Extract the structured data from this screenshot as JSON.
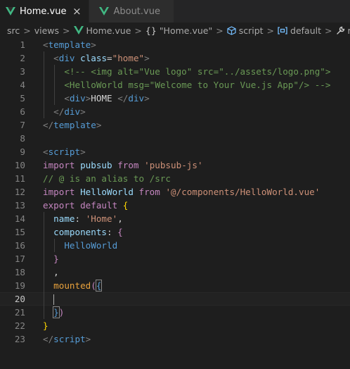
{
  "tabs": [
    {
      "label": "Home.vue",
      "active": true,
      "close": "×"
    },
    {
      "label": "About.vue",
      "active": false
    }
  ],
  "breadcrumb": {
    "items": [
      "src",
      "views",
      "Home.vue",
      "\"Home.vue\"",
      "script",
      "default",
      "mounted"
    ],
    "separator": ">",
    "braces": "{}"
  },
  "editor": {
    "line_numbers": [
      "1",
      "2",
      "3",
      "4",
      "5",
      "6",
      "7",
      "8",
      "9",
      "10",
      "11",
      "12",
      "13",
      "14",
      "15",
      "16",
      "17",
      "18",
      "19",
      "20",
      "21",
      "22",
      "23"
    ],
    "current_line": 20,
    "lines": [
      [
        {
          "t": "<",
          "c": "t-br"
        },
        {
          "t": "template",
          "c": "t-tag"
        },
        {
          "t": ">",
          "c": "t-br"
        }
      ],
      [
        {
          "t": "  "
        },
        {
          "t": "<",
          "c": "t-br"
        },
        {
          "t": "div",
          "c": "t-tag"
        },
        {
          "t": " "
        },
        {
          "t": "class",
          "c": "t-attr"
        },
        {
          "t": "=",
          "c": "t-pl"
        },
        {
          "t": "\"home\"",
          "c": "t-str"
        },
        {
          "t": ">",
          "c": "t-br"
        }
      ],
      [
        {
          "t": "    "
        },
        {
          "t": "<!-- <img alt=\"Vue logo\" src=\"../assets/logo.png\">",
          "c": "t-cm"
        }
      ],
      [
        {
          "t": "    "
        },
        {
          "t": "<HelloWorld msg=\"Welcome to Your Vue.js App\"/> -->",
          "c": "t-cm"
        }
      ],
      [
        {
          "t": "    "
        },
        {
          "t": "<",
          "c": "t-br"
        },
        {
          "t": "div",
          "c": "t-tag"
        },
        {
          "t": ">",
          "c": "t-br"
        },
        {
          "t": "HOME ",
          "c": "t-pl"
        },
        {
          "t": "</",
          "c": "t-br"
        },
        {
          "t": "div",
          "c": "t-tag"
        },
        {
          "t": ">",
          "c": "t-br"
        }
      ],
      [
        {
          "t": "  "
        },
        {
          "t": "</",
          "c": "t-br"
        },
        {
          "t": "div",
          "c": "t-tag"
        },
        {
          "t": ">",
          "c": "t-br"
        }
      ],
      [
        {
          "t": "</",
          "c": "t-br"
        },
        {
          "t": "template",
          "c": "t-tag"
        },
        {
          "t": ">",
          "c": "t-br"
        }
      ],
      [],
      [
        {
          "t": "<",
          "c": "t-br"
        },
        {
          "t": "script",
          "c": "t-tag"
        },
        {
          "t": ">",
          "c": "t-br"
        }
      ],
      [
        {
          "t": "import",
          "c": "t-kw"
        },
        {
          "t": " "
        },
        {
          "t": "pubsub",
          "c": "t-var"
        },
        {
          "t": " "
        },
        {
          "t": "from",
          "c": "t-kw"
        },
        {
          "t": " "
        },
        {
          "t": "'pubsub-js'",
          "c": "t-str"
        }
      ],
      [
        {
          "t": "// @ is an alias to /src",
          "c": "t-cm"
        }
      ],
      [
        {
          "t": "import",
          "c": "t-kw"
        },
        {
          "t": " "
        },
        {
          "t": "HelloWorld",
          "c": "t-var"
        },
        {
          "t": " "
        },
        {
          "t": "from",
          "c": "t-kw"
        },
        {
          "t": " "
        },
        {
          "t": "'@/components/HelloWorld.vue'",
          "c": "t-str"
        }
      ],
      [
        {
          "t": "export",
          "c": "t-kw"
        },
        {
          "t": " "
        },
        {
          "t": "default",
          "c": "t-kw"
        },
        {
          "t": " "
        },
        {
          "t": "{",
          "c": "t-gold"
        }
      ],
      [
        {
          "t": "  "
        },
        {
          "t": "name",
          "c": "t-var"
        },
        {
          "t": ": ",
          "c": "t-pl"
        },
        {
          "t": "'Home'",
          "c": "t-str"
        },
        {
          "t": ",",
          "c": "t-pl"
        }
      ],
      [
        {
          "t": "  "
        },
        {
          "t": "components",
          "c": "t-var"
        },
        {
          "t": ": ",
          "c": "t-pl"
        },
        {
          "t": "{",
          "c": "t-kw"
        }
      ],
      [
        {
          "t": "    "
        },
        {
          "t": "HelloWorld",
          "c": "t-blue"
        }
      ],
      [
        {
          "t": "  "
        },
        {
          "t": "}",
          "c": "t-kw"
        }
      ],
      [
        {
          "t": "  "
        },
        {
          "t": ",",
          "c": "t-pl"
        }
      ],
      [
        {
          "t": "  "
        },
        {
          "t": "mounted",
          "c": "t-mth"
        },
        {
          "t": "(",
          "c": "t-kw"
        },
        {
          "t": "{",
          "c": "t-blue",
          "bm": true
        }
      ],
      [
        {
          "t": "  "
        },
        {
          "t": "CARET"
        }
      ],
      [
        {
          "t": "  "
        },
        {
          "t": "}",
          "c": "t-blue",
          "bm": true
        },
        {
          "t": ")",
          "c": "t-kw"
        }
      ],
      [
        {
          "t": "}",
          "c": "t-gold"
        }
      ],
      [
        {
          "t": "</",
          "c": "t-br"
        },
        {
          "t": "script",
          "c": "t-tag"
        },
        {
          "t": ">",
          "c": "t-br"
        }
      ]
    ],
    "guides": [
      {
        "from": 2,
        "to": 6,
        "indent": 1
      },
      {
        "from": 3,
        "to": 5,
        "indent": 2
      },
      {
        "from": 14,
        "to": 21,
        "indent": 1
      },
      {
        "from": 16,
        "to": 16,
        "indent": 2
      },
      {
        "from": 20,
        "to": 20,
        "indent": 1
      }
    ]
  },
  "colors": {
    "background": "#1e1e1e",
    "tab_bar": "#252526",
    "vue_logo_green": "#41b883"
  },
  "icons": {
    "vue": "vue-logo-icon",
    "symbol_namespace": "cube-icon",
    "symbol_field": "field-icon",
    "symbol_method": "wrench-icon"
  }
}
